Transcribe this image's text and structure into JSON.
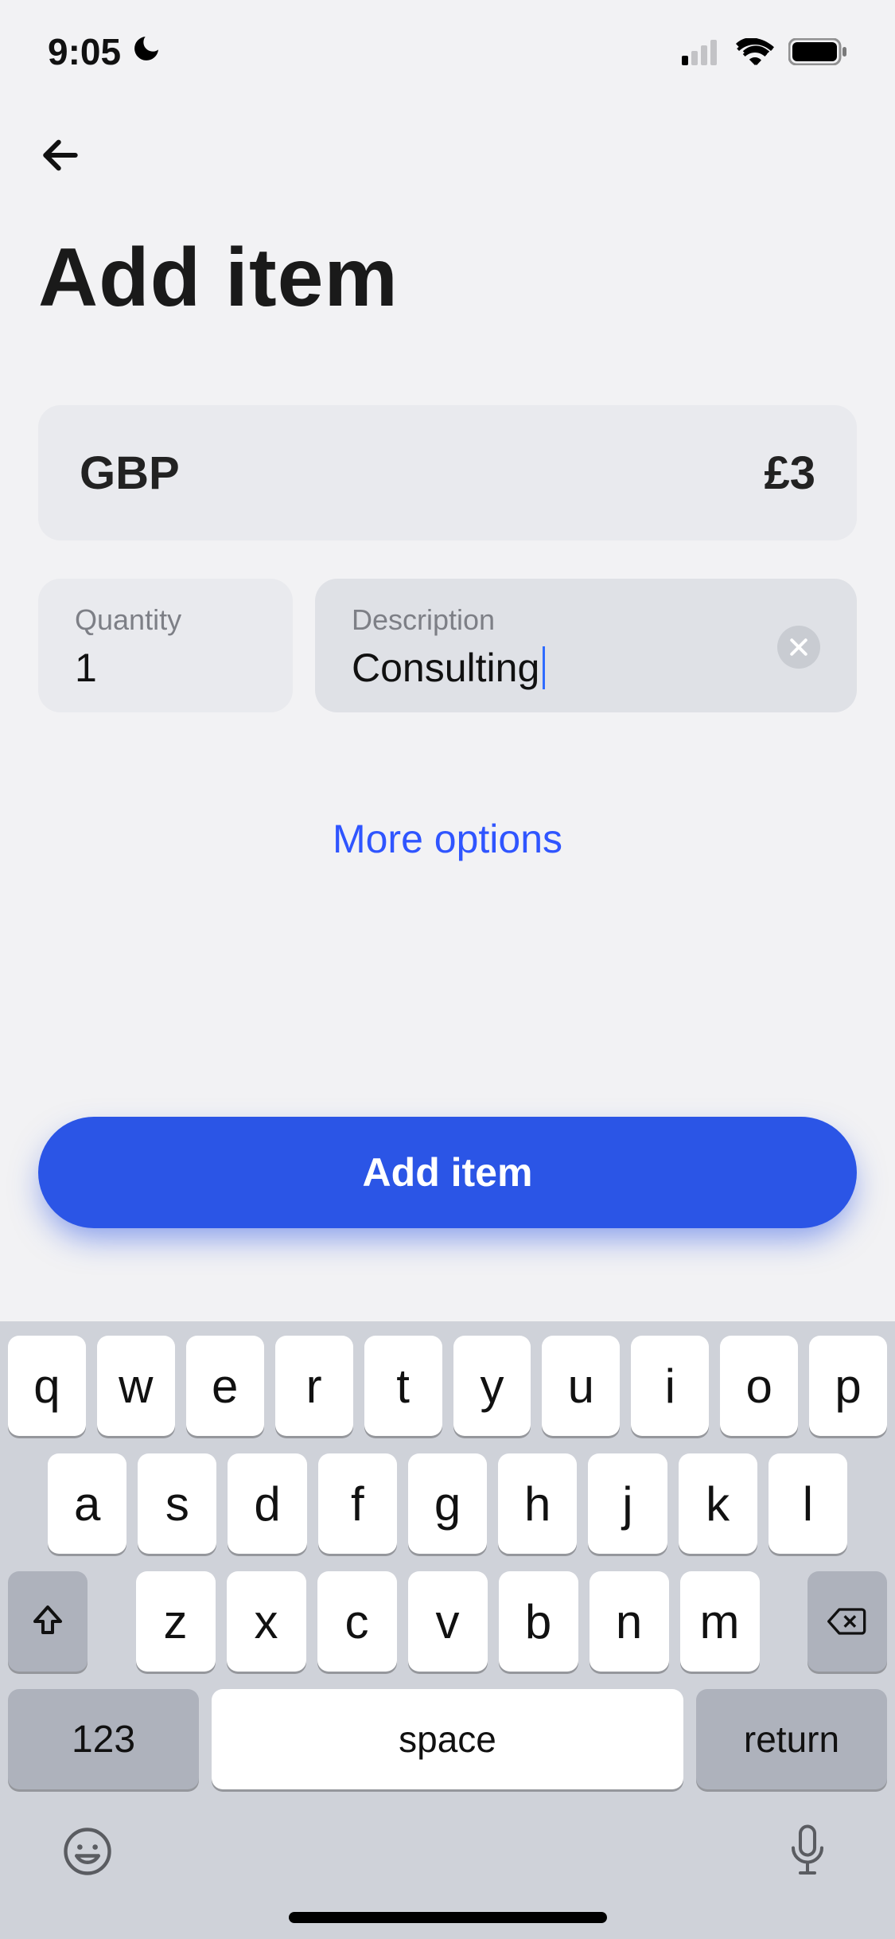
{
  "status": {
    "time": "9:05",
    "moon_icon": "moon-icon"
  },
  "header": {
    "title": "Add item"
  },
  "currency": {
    "code": "GBP",
    "amount": "£3"
  },
  "quantity": {
    "label": "Quantity",
    "value": "1"
  },
  "description": {
    "label": "Description",
    "value": "Consulting"
  },
  "more_options_label": "More options",
  "submit_label": "Add item",
  "keyboard": {
    "row1": [
      "q",
      "w",
      "e",
      "r",
      "t",
      "y",
      "u",
      "i",
      "o",
      "p"
    ],
    "row2": [
      "a",
      "s",
      "d",
      "f",
      "g",
      "h",
      "j",
      "k",
      "l"
    ],
    "row3": [
      "z",
      "x",
      "c",
      "v",
      "b",
      "n",
      "m"
    ],
    "n123": "123",
    "space": "space",
    "return": "return"
  }
}
